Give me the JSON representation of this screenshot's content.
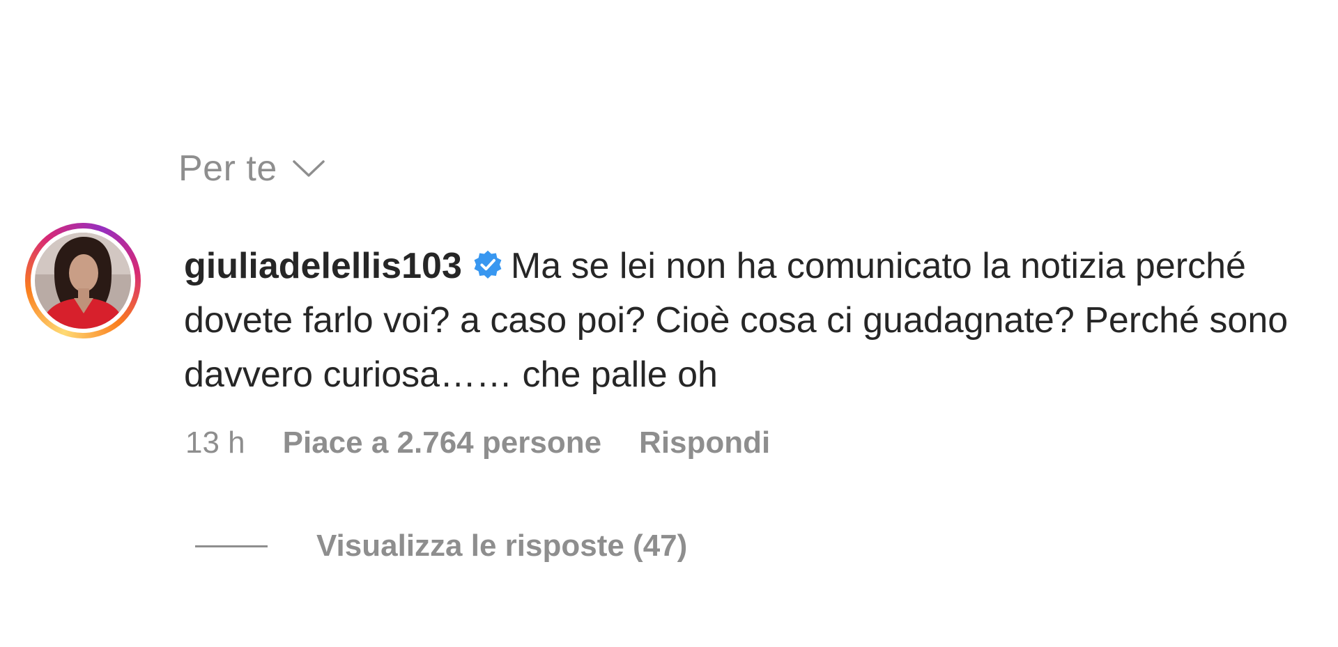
{
  "sort": {
    "label": "Per te",
    "icon": "chevron-down-icon"
  },
  "comment": {
    "username": "giuliadelellis103",
    "verified_icon": "verified-badge-icon",
    "verified_color": "#3897f0",
    "text": "Ma se lei non ha comunicato la notizia perché dovete farlo voi? a caso poi? Cioè cosa ci guadagnate? Perché sono davvero curiosa…… che palle oh",
    "time": "13 h",
    "likes": "Piace a 2.764 persone",
    "reply": "Rispondi"
  },
  "replies": {
    "label": "Visualizza le risposte (47)"
  },
  "colors": {
    "primary_text": "#262626",
    "secondary_text": "#8e8e8e",
    "background": "#ffffff"
  }
}
